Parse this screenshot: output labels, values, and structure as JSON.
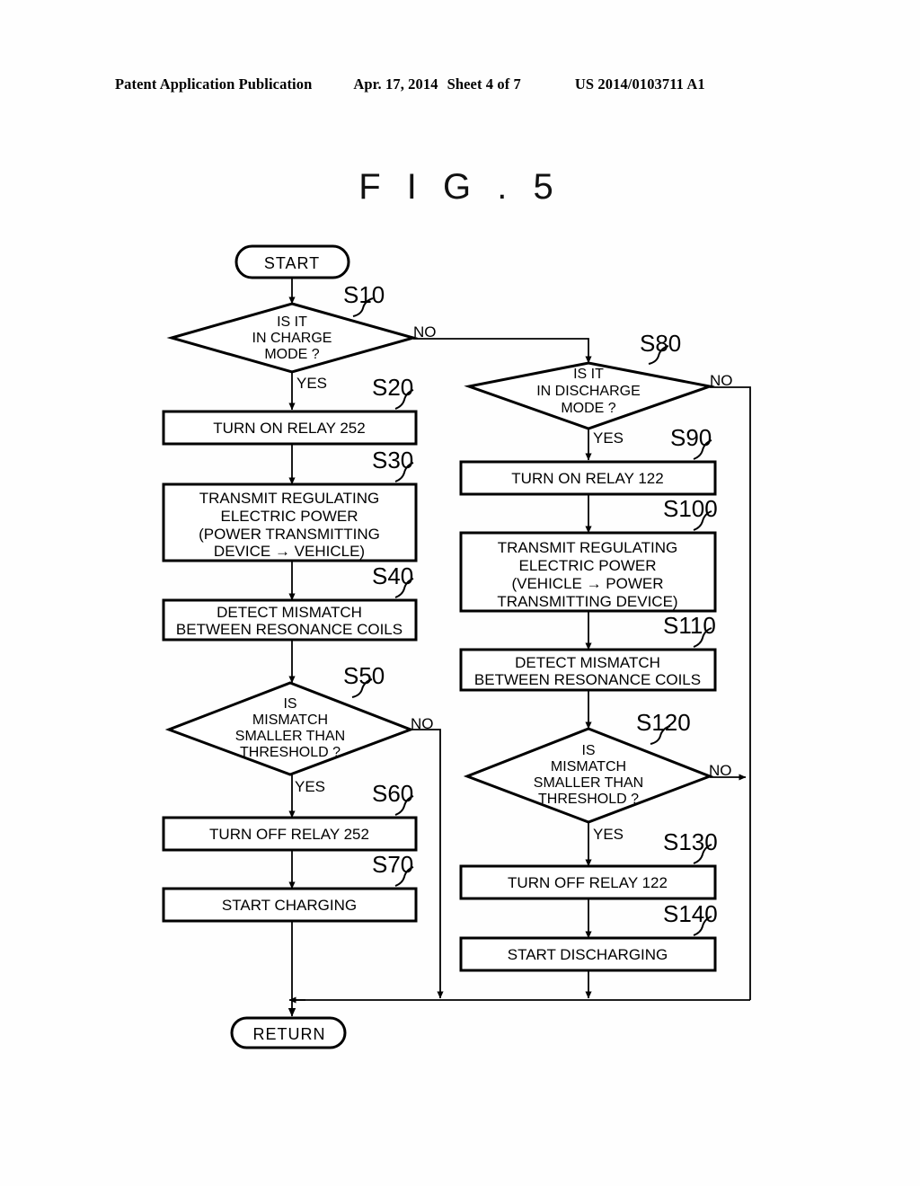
{
  "header": {
    "publication": "Patent Application Publication",
    "date": "Apr. 17, 2014",
    "sheet": "Sheet 4 of 7",
    "doc_number": "US 2014/0103711 A1"
  },
  "figure": {
    "title": "F I G . 5"
  },
  "flowchart": {
    "terminators": {
      "start": "START",
      "return": "RETURN"
    },
    "branch_labels": {
      "yes": "YES",
      "no": "NO"
    },
    "nodes": [
      {
        "id": "S10",
        "step": "S10",
        "kind": "decision",
        "lines": [
          "IS IT",
          "IN CHARGE",
          "MODE ?"
        ]
      },
      {
        "id": "S20",
        "step": "S20",
        "kind": "process",
        "lines": [
          "TURN ON RELAY 252"
        ]
      },
      {
        "id": "S30",
        "step": "S30",
        "kind": "process",
        "lines": [
          "TRANSMIT REGULATING",
          "ELECTRIC POWER",
          "(POWER TRANSMITTING",
          "DEVICE → VEHICLE)"
        ]
      },
      {
        "id": "S40",
        "step": "S40",
        "kind": "process",
        "lines": [
          "DETECT MISMATCH",
          "BETWEEN RESONANCE COILS"
        ]
      },
      {
        "id": "S50",
        "step": "S50",
        "kind": "decision",
        "lines": [
          "IS",
          "MISMATCH",
          "SMALLER THAN",
          "THRESHOLD ?"
        ]
      },
      {
        "id": "S60",
        "step": "S60",
        "kind": "process",
        "lines": [
          "TURN OFF RELAY 252"
        ]
      },
      {
        "id": "S70",
        "step": "S70",
        "kind": "process",
        "lines": [
          "START CHARGING"
        ]
      },
      {
        "id": "S80",
        "step": "S80",
        "kind": "decision",
        "lines": [
          "IS IT",
          "IN DISCHARGE",
          "MODE ?"
        ]
      },
      {
        "id": "S90",
        "step": "S90",
        "kind": "process",
        "lines": [
          "TURN ON RELAY 122"
        ]
      },
      {
        "id": "S100",
        "step": "S100",
        "kind": "process",
        "lines": [
          "TRANSMIT REGULATING",
          "ELECTRIC POWER",
          "(VEHICLE → POWER",
          "TRANSMITTING DEVICE)"
        ]
      },
      {
        "id": "S110",
        "step": "S110",
        "kind": "process",
        "lines": [
          "DETECT MISMATCH",
          "BETWEEN RESONANCE COILS"
        ]
      },
      {
        "id": "S120",
        "step": "S120",
        "kind": "decision",
        "lines": [
          "IS",
          "MISMATCH",
          "SMALLER THAN",
          "THRESHOLD ?"
        ]
      },
      {
        "id": "S130",
        "step": "S130",
        "kind": "process",
        "lines": [
          "TURN OFF RELAY 122"
        ]
      },
      {
        "id": "S140",
        "step": "S140",
        "kind": "process",
        "lines": [
          "START DISCHARGING"
        ]
      }
    ]
  }
}
